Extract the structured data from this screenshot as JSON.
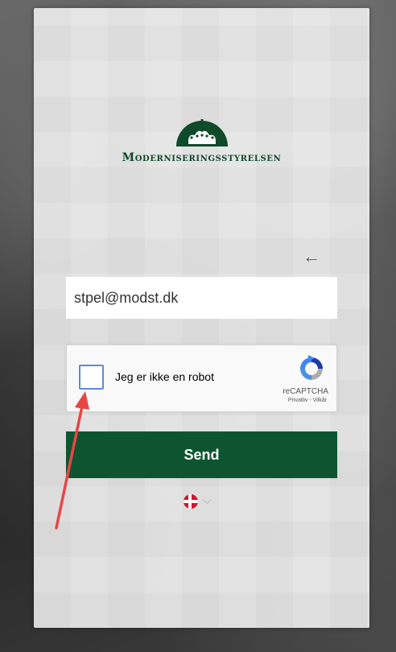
{
  "brand": {
    "name": "Moderniseringsstyrelsen",
    "color": "#0f4a2a"
  },
  "form": {
    "email_value": "stpel@modst.dk",
    "send_label": "Send"
  },
  "recaptcha": {
    "checkbox_label": "Jeg er ikke en robot",
    "brand": "reCAPTCHA",
    "links": "Privatliv - Vilkår"
  },
  "language": {
    "selected": "da",
    "chevron": "⌵"
  },
  "colors": {
    "primary": "#0d5530",
    "annotation_arrow": "#e84545",
    "checkbox_border": "#5f8bd8"
  },
  "icons": {
    "back": "←"
  }
}
